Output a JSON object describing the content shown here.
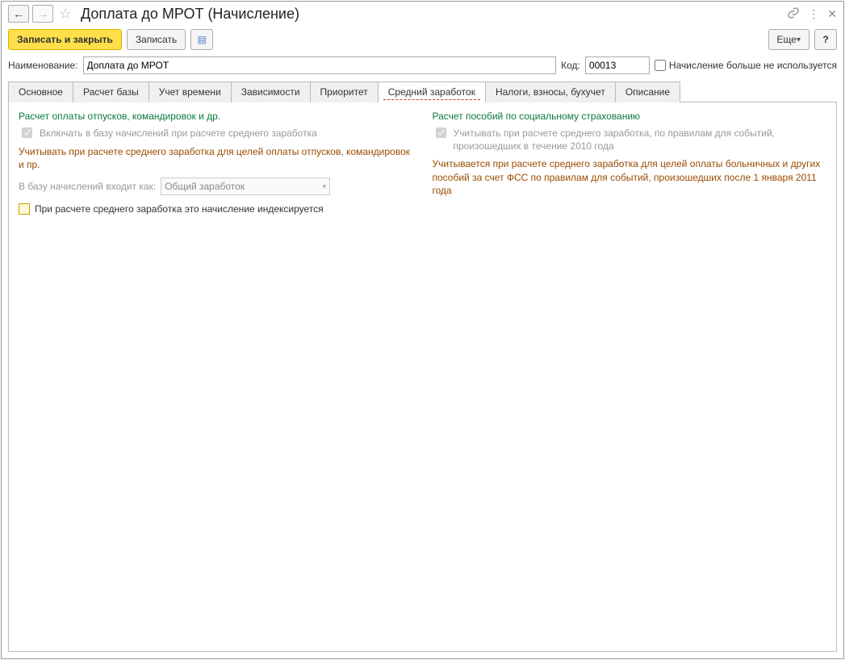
{
  "title": "Доплата до МРОТ (Начисление)",
  "toolbar": {
    "save_close": "Записать и закрыть",
    "save": "Записать",
    "more": "Еще",
    "help": "?"
  },
  "form": {
    "name_label": "Наименование:",
    "name_value": "Доплата до МРОТ",
    "code_label": "Код:",
    "code_value": "00013",
    "unused_label": "Начисление больше не используется"
  },
  "tabs": {
    "main": "Основное",
    "base": "Расчет базы",
    "time": "Учет времени",
    "deps": "Зависимости",
    "priority": "Приоритет",
    "avg": "Средний заработок",
    "tax": "Налоги, взносы, бухучет",
    "desc": "Описание"
  },
  "left": {
    "title": "Расчет оплаты отпусков, командировок и др.",
    "check1": "Включать в базу начислений при расчете среднего заработка",
    "brown1": "Учитывать при расчете среднего заработка для целей оплаты отпусков, командировок и пр.",
    "combo_label": "В базу начислений входит как:",
    "combo_value": "Общий заработок",
    "index_label": "При расчете среднего заработка это начисление индексируется"
  },
  "right": {
    "title": "Расчет пособий по социальному страхованию",
    "check1": "Учитывать при расчете среднего заработка, по правилам для событий, произошедших в течение 2010 года",
    "brown1": "Учитывается при расчете среднего заработка для целей оплаты больничных и других пособий за счет ФСС по правилам для событий, произошедших после 1 января 2011 года"
  }
}
